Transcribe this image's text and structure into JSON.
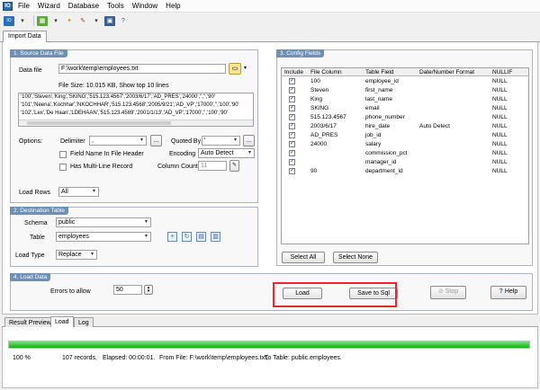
{
  "menu": [
    "File",
    "Wizard",
    "Database",
    "Tools",
    "Window",
    "Help"
  ],
  "toolbar_icons": [
    "app-icon",
    "save-icon",
    "table-icon",
    "wizard-icon",
    "sql-icon",
    "options-icon",
    "help-icon"
  ],
  "tab_import": "Import Data",
  "source": {
    "title": "1. Source Data File",
    "data_file_label": "Data file",
    "data_file_value": "F:\\work\\temp\\employees.txt",
    "file_size": "File Size: 10.015 KB,  Show top 10 lines",
    "preview_lines": [
      "'100','Steven','King','SKING','515.123.4567','2003/6/17','AD_PRES','24000','','','90'",
      "'101','Neena','Kochhar','NKOCHHAR','515.123.4568','2005/9/21','AD_VP','17000','','100','90'",
      "'102','Lex','De Haan','LDEHAAN','515.123.4569','2001/1/13','AD_VP','17000','','100','90'"
    ],
    "options_label": "Options:",
    "delimiter_label": "Delimiter",
    "delimiter_value": ",",
    "quoted_by_label": "Quoted By",
    "quoted_by_value": "'",
    "field_name_header_label": "Field Name In File Header",
    "multiline_label": "Has Multi-Line Record",
    "encoding_label": "Encoding",
    "encoding_value": "Auto Detect",
    "column_count_label": "Column Count",
    "column_count_value": "11",
    "load_rows_label": "Load Rows",
    "load_rows_value": "All",
    "browse_label": "..."
  },
  "destination": {
    "title": "2. Destination Table",
    "schema_label": "Schema",
    "schema_value": "public",
    "table_label": "Table",
    "table_value": "employees",
    "load_type_label": "Load Type",
    "load_type_value": "Replace"
  },
  "config": {
    "title": "3. Config Fields",
    "headers": [
      "Include",
      "File Column",
      "Table Field",
      "Date/Number Format",
      "NULLIF"
    ],
    "rows": [
      {
        "file_col": "100",
        "table_field": "employee_id",
        "format": "",
        "nullif": "NULL"
      },
      {
        "file_col": "Steven",
        "table_field": "first_name",
        "format": "",
        "nullif": "NULL"
      },
      {
        "file_col": "King",
        "table_field": "last_name",
        "format": "",
        "nullif": "NULL"
      },
      {
        "file_col": "SKING",
        "table_field": "email",
        "format": "",
        "nullif": "NULL"
      },
      {
        "file_col": "515.123.4567",
        "table_field": "phone_number",
        "format": "",
        "nullif": "NULL"
      },
      {
        "file_col": "2003/6/17",
        "table_field": "hire_date",
        "format": "Auto Detect",
        "nullif": "NULL"
      },
      {
        "file_col": "AD_PRES",
        "table_field": "job_id",
        "format": "",
        "nullif": "NULL"
      },
      {
        "file_col": "24000",
        "table_field": "salary",
        "format": "",
        "nullif": "NULL"
      },
      {
        "file_col": "",
        "table_field": "commission_pct",
        "format": "",
        "nullif": "NULL"
      },
      {
        "file_col": "",
        "table_field": "manager_id",
        "format": "",
        "nullif": "NULL"
      },
      {
        "file_col": "90",
        "table_field": "department_id",
        "format": "",
        "nullif": "NULL"
      }
    ],
    "select_all_label": "Select All",
    "select_none_label": "Select None"
  },
  "load": {
    "title": "4. Load Data",
    "errors_label": "Errors to allow",
    "errors_value": "50",
    "load_button": "Load",
    "save_sql_button": "Save to Sql",
    "stop_button": "Stop",
    "help_button": "Help"
  },
  "bottom_tabs": [
    "Result Preview",
    "Load",
    "Log"
  ],
  "progress": {
    "value": 1.0
  },
  "status": {
    "percent": "100 %",
    "records": "107 records,",
    "elapsed": "Elapsed: 00:00:01.",
    "from": "From File: F:\\work\\temp\\employees.txt,",
    "to": "To Table: public.employees."
  },
  "colors": {
    "accent": "#6f8fb4",
    "highlight": "#e8282c",
    "progress": "#12b012"
  }
}
